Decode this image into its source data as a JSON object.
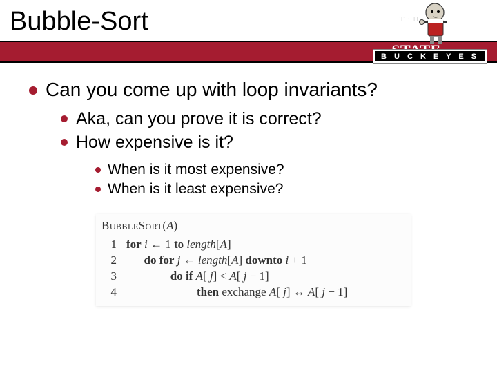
{
  "logo": {
    "top_line": "T · H · E",
    "main_line": "OHIO STATE",
    "bottom_line": "B U C K E Y E S"
  },
  "title": "Bubble-Sort",
  "bullets": {
    "l1": "Can you come up with loop invariants?",
    "l2a": "Aka, can you prove it is correct?",
    "l2b": "How expensive is it?",
    "l3a": "When is it most expensive?",
    "l3b": "When is it least expensive?"
  },
  "pseudocode": {
    "header_name": "BubbleSort",
    "header_arg": "A",
    "lines": [
      {
        "num": "1",
        "indent": "",
        "kw": "for",
        "rest_html": " <span class='it'>i</span> ← 1 <span class='kw'>to</span> <span class='it'>length</span>[<span class='it'>A</span>]"
      },
      {
        "num": "2",
        "indent": "      ",
        "kw": "do for",
        "rest_html": " <span class='it'>j</span> ← <span class='it'>length</span>[<span class='it'>A</span>] <span class='kw'>downto</span> <span class='it'>i</span> + 1"
      },
      {
        "num": "3",
        "indent": "               ",
        "kw": "do if",
        "rest_html": " <span class='it'>A</span>[ <span class='it'>j</span>] < <span class='it'>A</span>[ <span class='it'>j</span> − 1]"
      },
      {
        "num": "4",
        "indent": "                        ",
        "kw": "then",
        "rest_html": " exchange <span class='it'>A</span>[ <span class='it'>j</span>] ↔ <span class='it'>A</span>[ <span class='it'>j</span> − 1]"
      }
    ]
  }
}
